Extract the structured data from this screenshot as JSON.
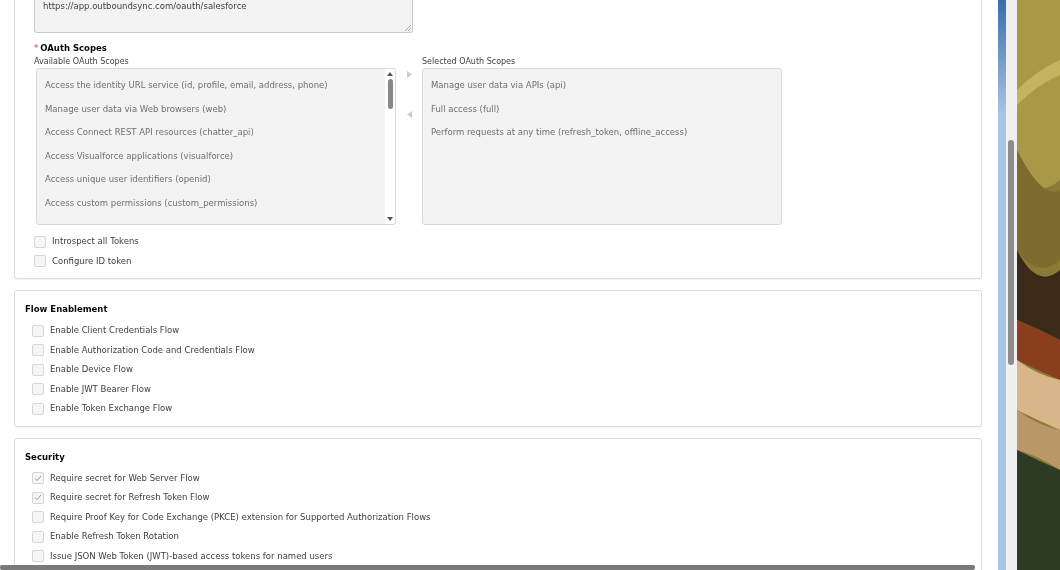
{
  "callback_url": {
    "value": "https://app.outboundsync.com/oauth/salesforce"
  },
  "oauth_scopes": {
    "required_mark": "*",
    "label": "OAuth Scopes",
    "available_label": "Available OAuth Scopes",
    "available": [
      {
        "label": "Access the identity URL service (id, profile, email, address, phone)"
      },
      {
        "label": "Manage user data via Web browsers (web)"
      },
      {
        "label": "Access Connect REST API resources (chatter_api)"
      },
      {
        "label": "Access Visualforce applications (visualforce)"
      },
      {
        "label": "Access unique user identifiers (openid)"
      },
      {
        "label": "Access custom permissions (custom_permissions)"
      }
    ],
    "selected_label": "Selected OAuth Scopes",
    "selected": [
      {
        "label": "Manage user data via APIs (api)"
      },
      {
        "label": "Full access (full)"
      },
      {
        "label": "Perform requests at any time (refresh_token, offline_access)"
      }
    ]
  },
  "scope_options": [
    {
      "label": "Introspect all Tokens",
      "checked": false
    },
    {
      "label": "Configure ID token",
      "checked": false
    }
  ],
  "sections": [
    {
      "title": "Flow Enablement",
      "options": [
        {
          "label": "Enable Client Credentials Flow",
          "checked": false
        },
        {
          "label": "Enable Authorization Code and Credentials Flow",
          "checked": false
        },
        {
          "label": "Enable Device Flow",
          "checked": false
        },
        {
          "label": "Enable JWT Bearer Flow",
          "checked": false
        },
        {
          "label": "Enable Token Exchange Flow",
          "checked": false
        }
      ]
    },
    {
      "title": "Security",
      "options": [
        {
          "label": "Require secret for Web Server Flow",
          "checked": true
        },
        {
          "label": "Require secret for Refresh Token Flow",
          "checked": true
        },
        {
          "label": "Require Proof Key for Code Exchange (PKCE) extension for Supported Authorization Flows",
          "checked": false
        },
        {
          "label": "Enable Refresh Token Rotation",
          "checked": false
        },
        {
          "label": "Issue JSON Web Token (JWT)-based access tokens for named users",
          "checked": false
        }
      ]
    }
  ]
}
